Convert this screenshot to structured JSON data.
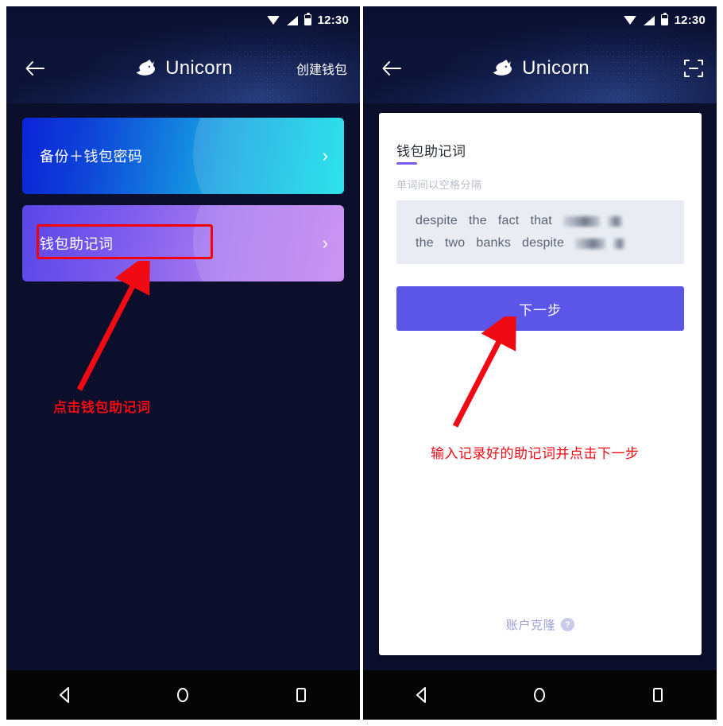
{
  "statusbar": {
    "time": "12:30",
    "icons": [
      "wifi-icon",
      "signal-icon",
      "battery-icon"
    ]
  },
  "left_panel": {
    "appbar": {
      "back_icon": "back-arrow-icon",
      "logo_icon": "unicorn-logo-icon",
      "brand": "Unicorn",
      "action_label": "创建钱包"
    },
    "cards": [
      {
        "label": "备份＋钱包密码",
        "chevron": "›",
        "accent": "#0e45d8"
      },
      {
        "label": "钱包助记词",
        "chevron": "›",
        "accent": "#7b5bee"
      }
    ],
    "annotation": "点击钱包助记词",
    "annotation_color": "#ef0a14",
    "highlight_color": "#f3000b"
  },
  "right_panel": {
    "appbar": {
      "back_icon": "back-arrow-icon",
      "logo_icon": "unicorn-logo-icon",
      "brand": "Unicorn",
      "scan_icon": "scan-qr-icon"
    },
    "sheet": {
      "title": "钱包助记词",
      "hint": "单词间以空格分隔",
      "mnemonic": {
        "line1_words": [
          "despite",
          "the",
          "fact",
          "that"
        ],
        "line1_redacted": [
          46,
          18
        ],
        "line2_words": [
          "the",
          "two",
          "banks",
          "despite"
        ],
        "line2_redacted": [
          38,
          14
        ]
      },
      "next_button": "下一步",
      "clone_link": "账户克隆",
      "help_icon": "?"
    },
    "annotation": "输入记录好的助记词并点击下一步",
    "annotation_color": "#ef0a14"
  },
  "navbar": {
    "back": "nav-back-icon",
    "home": "nav-home-icon",
    "recents": "nav-recents-icon"
  }
}
